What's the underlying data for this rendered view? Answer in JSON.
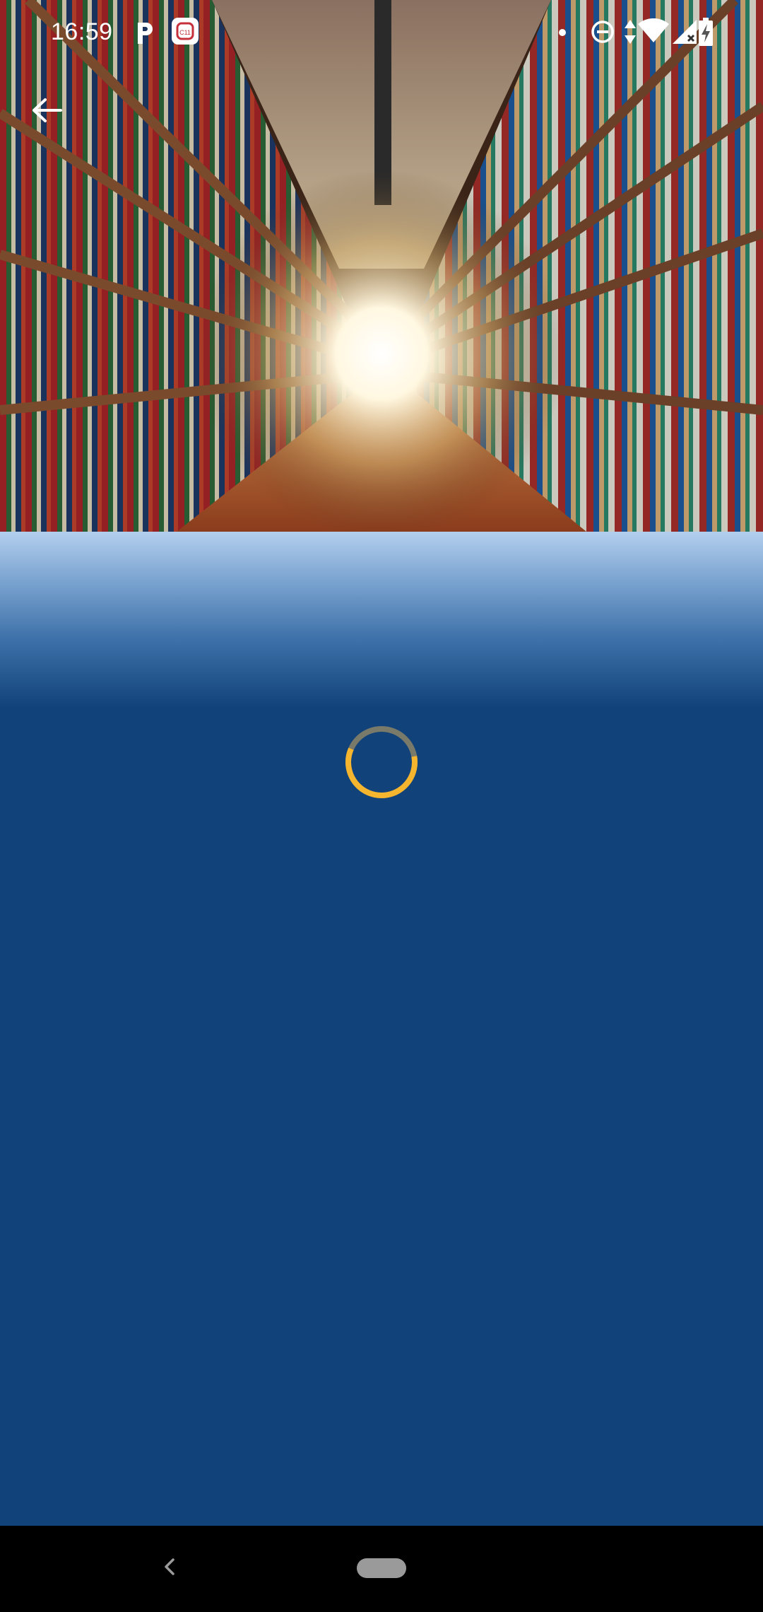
{
  "status_bar": {
    "time": "16:59",
    "left_icons": [
      "parking-p-icon",
      "app-notification-icon"
    ],
    "right_icons": [
      "dot-icon",
      "do-not-disturb-icon",
      "data-transfer-icon",
      "wifi-icon",
      "cell-signal-icon",
      "battery-charging-icon"
    ]
  },
  "toolbar": {
    "back_icon": "arrow-left-icon"
  },
  "hero": {
    "image": "library-aisle-bookshelves-photo"
  },
  "content": {
    "loading_indicator": "loading-spinner",
    "spinner_colors": {
      "track": "#7a7a6a",
      "arc": "#f5b52e"
    }
  },
  "nav_bar": {
    "back_icon": "chevron-left-icon",
    "home_icon": "home-pill-icon"
  }
}
